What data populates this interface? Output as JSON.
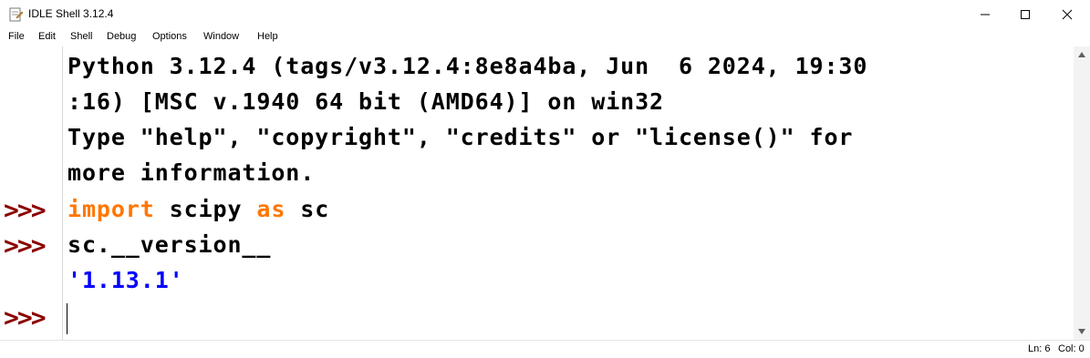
{
  "window": {
    "title": "IDLE Shell 3.12.4",
    "controls": [
      "minimize",
      "maximize",
      "close"
    ]
  },
  "menu": {
    "items": [
      "File",
      "Edit",
      "Shell",
      "Debug",
      "Options",
      "Window",
      "Help"
    ]
  },
  "shell": {
    "banner_line1": "Python 3.12.4 (tags/v3.12.4:8e8a4ba, Jun  6 2024, 19:30",
    "banner_line2": ":16) [MSC v.1940 64 bit (AMD64)] on win32",
    "banner_line3": "Type \"help\", \"copyright\", \"credits\" or \"license()\" for",
    "banner_line4": "more information.",
    "prompt": ">>>",
    "cmd1_kw1": "import",
    "cmd1_mid": " scipy ",
    "cmd1_kw2": "as",
    "cmd1_end": " sc",
    "cmd2": "sc.__version__",
    "output": "'1.13.1'"
  },
  "status": {
    "line": "Ln: 6",
    "col": "Col: 0"
  },
  "colors": {
    "prompt": "#8b0000",
    "keyword": "#ff7700",
    "string": "#0000ff"
  }
}
